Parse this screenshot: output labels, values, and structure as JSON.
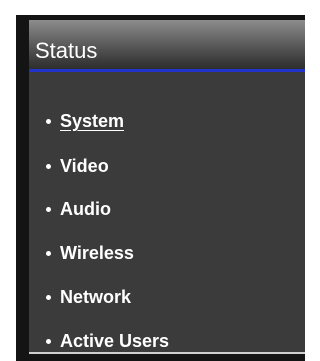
{
  "panel": {
    "title": "Status"
  },
  "nav": {
    "items": [
      {
        "label": "System",
        "active": true
      },
      {
        "label": "Video",
        "active": false
      },
      {
        "label": "Audio",
        "active": false
      },
      {
        "label": "Wireless",
        "active": false
      },
      {
        "label": "Network",
        "active": false
      },
      {
        "label": "Active Users",
        "active": false
      }
    ]
  },
  "colors": {
    "header_underline": "#2233cc",
    "body_background": "#3b3b3b",
    "text": "#ffffff"
  }
}
